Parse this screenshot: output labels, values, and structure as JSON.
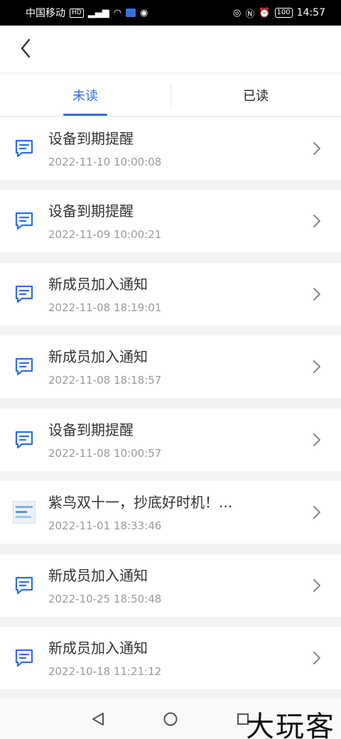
{
  "status_bar": {
    "carrier": "中国移动",
    "hd_badge": "HD",
    "net_type": "4G",
    "battery": "100",
    "time": "14:57"
  },
  "header": {
    "back_icon": "chevron-left-icon"
  },
  "tabs": [
    {
      "label": "未读",
      "active": true
    },
    {
      "label": "已读",
      "active": false
    }
  ],
  "messages": [
    {
      "title": "设备到期提醒",
      "time": "2022-11-10 10:00:08",
      "icon": "message-icon"
    },
    {
      "title": "设备到期提醒",
      "time": "2022-11-09 10:00:21",
      "icon": "message-icon"
    },
    {
      "title": "新成员加入通知",
      "time": "2022-11-08 18:19:01",
      "icon": "message-icon"
    },
    {
      "title": "新成员加入通知",
      "time": "2022-11-08 18:18:57",
      "icon": "message-icon"
    },
    {
      "title": "设备到期提醒",
      "time": "2022-11-08 10:00:57",
      "icon": "message-icon"
    },
    {
      "title": "紫鸟双十一，抄底好时机！...",
      "time": "2022-11-01 18:33:46",
      "icon": "thumbnail-image"
    },
    {
      "title": "新成员加入通知",
      "time": "2022-10-25 18:50:48",
      "icon": "message-icon"
    },
    {
      "title": "新成员加入通知",
      "time": "2022-10-18 11:21:12",
      "icon": "message-icon"
    }
  ],
  "colors": {
    "accent": "#2f6ee6",
    "background": "#f2f3f5"
  },
  "watermark": "大玩客"
}
